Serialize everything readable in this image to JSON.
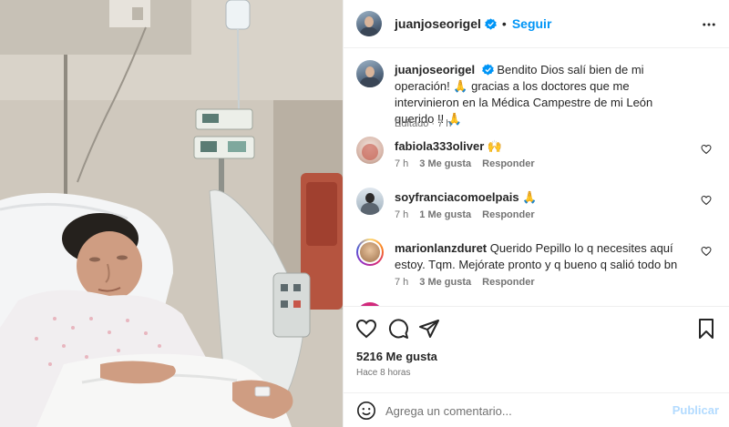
{
  "post": {
    "username": "juanjoseorigel",
    "follow_label": "Seguir",
    "separator": "•",
    "caption": "Bendito Dios salí bien de mi operación! 🙏 gracias a los doctores que me intervinieron en la Médica Campestre de mi León querido !! 🙏",
    "caption_meta": "Editado · 7 h"
  },
  "comments": [
    {
      "username": "fabiola333oliver",
      "text": "🙌",
      "time": "7 h",
      "likes": "3 Me gusta",
      "reply": "Responder"
    },
    {
      "username": "soyfranciacomoelpais",
      "text": "🙏",
      "time": "7 h",
      "likes": "1 Me gusta",
      "reply": "Responder"
    },
    {
      "username": "marionlanzduret",
      "text": "Querido Pepillo lo q necesites aquí estoy. Tqm. Mejórate pronto y q bueno q salió todo bn",
      "time": "7 h",
      "likes": "3 Me gusta",
      "reply": "Responder"
    }
  ],
  "actions": {
    "likes": "5216 Me gusta",
    "time": "Hace 8 horas",
    "icons": [
      "heart-icon",
      "comment-icon",
      "share-icon",
      "bookmark-icon"
    ]
  },
  "compose": {
    "placeholder": "Agrega un comentario...",
    "publish_label": "Publicar"
  },
  "colors": {
    "accent": "#0095f6",
    "publish_disabled": "#b3dbff",
    "muted": "#737373",
    "text": "#262626"
  }
}
